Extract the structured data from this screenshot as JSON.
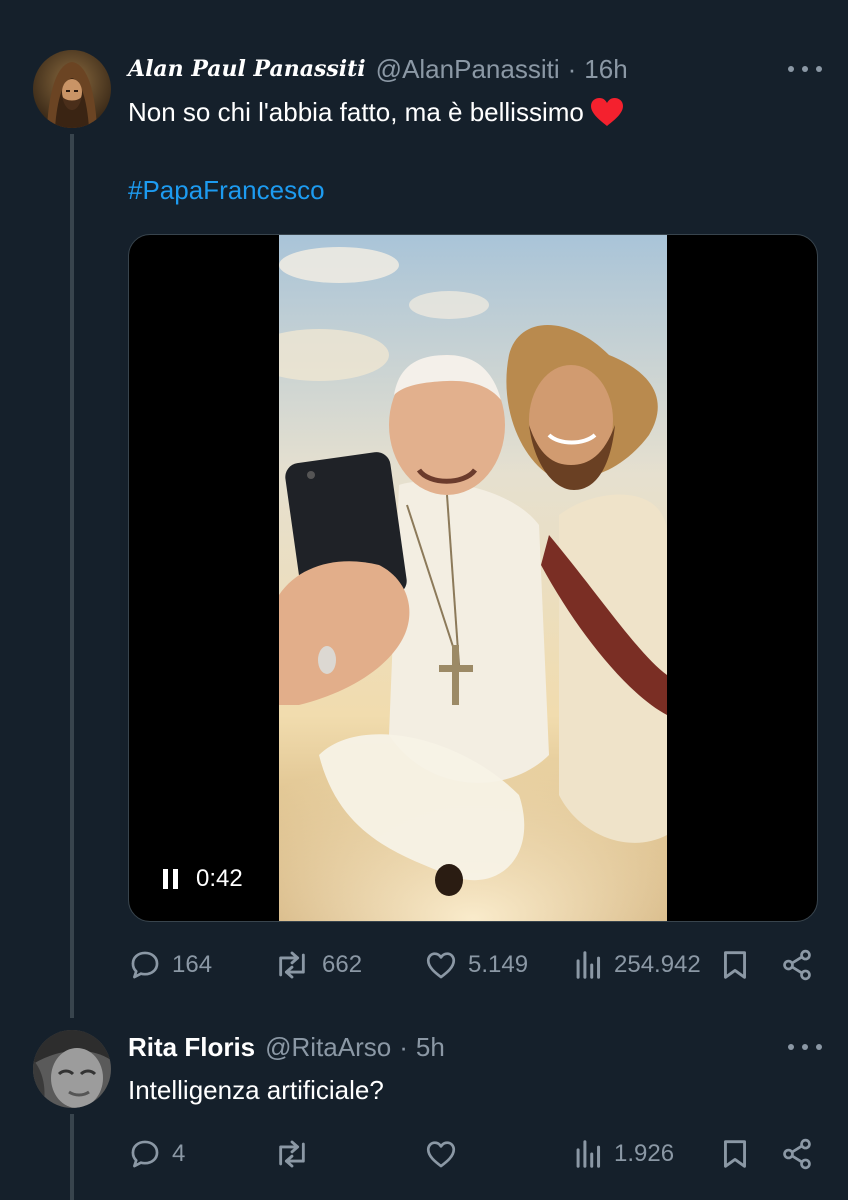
{
  "tweet": {
    "display_name": "Alan Paul Panassiti",
    "handle": "@AlanPanassiti",
    "separator": "·",
    "time": "16h",
    "text": "Non so chi l'abbia fatto, ma è bellissimo",
    "emoji": "red-heart",
    "hashtag": "#PapaFrancesco",
    "video": {
      "state": "playing",
      "time": "0:42"
    },
    "stats": {
      "replies": "164",
      "retweets": "662",
      "likes": "5.149",
      "views": "254.942"
    }
  },
  "reply": {
    "display_name": "Rita Floris",
    "handle": "@RitaArso",
    "separator": "·",
    "time": "5h",
    "text": "Intelligenza artificiale?",
    "stats": {
      "replies": "4",
      "views": "1.926"
    }
  },
  "colors": {
    "background": "#15202b",
    "secondary_text": "#8b98a5",
    "link": "#1d9bf0",
    "heart": "#f4212e"
  }
}
